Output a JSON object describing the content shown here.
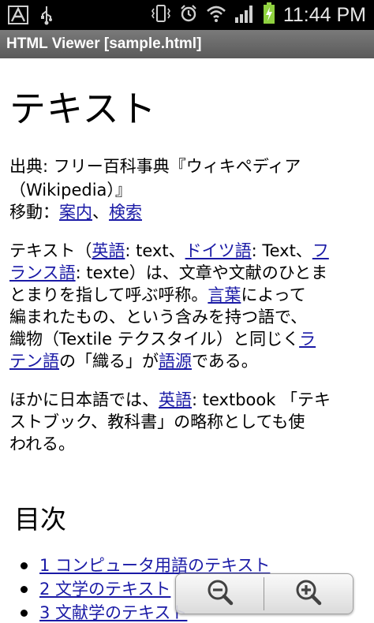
{
  "status_bar": {
    "time": "11:44 PM",
    "icons": [
      "notification-a-icon",
      "usb-icon",
      "vibrate-icon",
      "alarm-icon",
      "wifi-icon",
      "signal-icon",
      "battery-charging-icon"
    ]
  },
  "app_title": "HTML Viewer [sample.html]",
  "article": {
    "title": "テキスト",
    "source_line1": "出典: フリー百科事典『ウィキペディア",
    "source_line2": "（Wikipedia）』",
    "nav_prefix": "移動：",
    "nav_link1": "案内",
    "nav_sep": "、",
    "nav_link2": "検索",
    "p1": {
      "l1_a": "テキスト（",
      "l1_link1": "英語",
      "l1_b": ": text、",
      "l1_link2": "ドイツ語",
      "l1_c": ": Text、",
      "l1_link3a": "フ",
      "l2_link3b": "ランス語",
      "l2_b": ": texte）は、文章や文献のひとま",
      "l3": "とまりを指して呼ぶ呼称。",
      "l3_link": "言葉",
      "l3_b": "によって",
      "l4": "編まれたもの、という含みを持つ語で、",
      "l5_a": "織物（Textile テクスタイル）と同じく",
      "l5_link": "ラ",
      "l6_link1": "テン語",
      "l6_b": "の「織る」が",
      "l6_link2": "語源",
      "l6_c": "である。"
    },
    "p2": {
      "l1_a": "ほかに日本語では、",
      "l1_link": "英語",
      "l1_b": ": textbook 「テキ",
      "l2": "ストブック、教科書」の略称としても使",
      "l3": "われる。"
    },
    "toc_title": "目次",
    "toc_items": [
      "1 コンピュータ用語のテキスト",
      "2 文学のテキスト",
      "3 文献学のテキスト"
    ]
  },
  "zoom": {
    "out_icon": "zoom-out-icon",
    "in_icon": "zoom-in-icon"
  },
  "colors": {
    "link": "#1a1aa6",
    "status_bar_bg": "#000000",
    "title_bar_bg": "#6a6a6a"
  }
}
